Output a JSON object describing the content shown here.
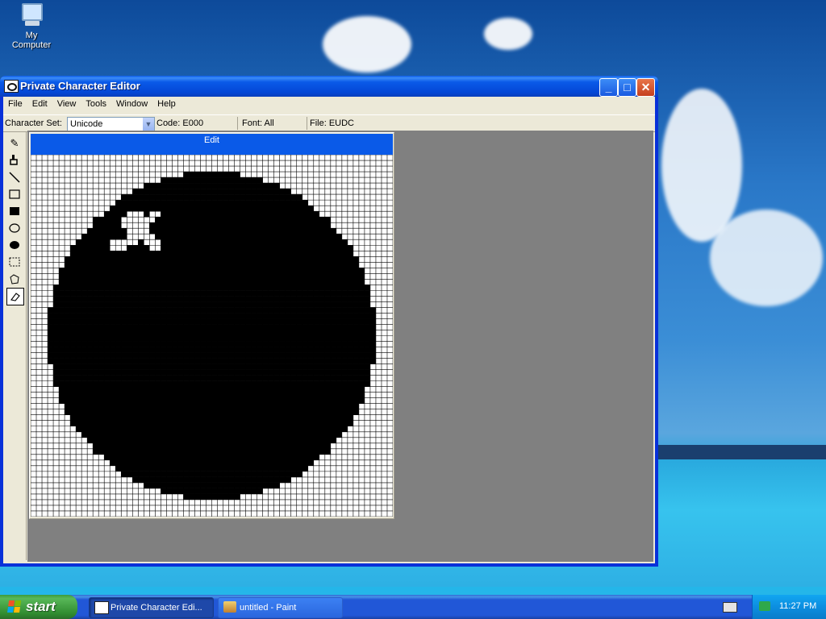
{
  "desktop": {
    "icons": [
      {
        "label": "My Computer",
        "icon": "my-computer-icon"
      }
    ]
  },
  "window": {
    "title": "Private Character Editor",
    "controls": {
      "minimize": "_",
      "maximize": "□",
      "close": "✕"
    },
    "menu": [
      "File",
      "Edit",
      "View",
      "Tools",
      "Window",
      "Help"
    ],
    "info": {
      "charset_label": "Character Set:",
      "charset_value": "Unicode",
      "code": "Code: E000",
      "font": "Font: All",
      "file": "File: EUDC"
    },
    "tools": [
      {
        "name": "pencil-tool",
        "glyph": "✎"
      },
      {
        "name": "brush-tool",
        "glyph": "🖌"
      },
      {
        "name": "line-tool",
        "glyph": "╲"
      },
      {
        "name": "hollow-rectangle-tool",
        "glyph": "□"
      },
      {
        "name": "filled-rectangle-tool",
        "glyph": "■"
      },
      {
        "name": "hollow-ellipse-tool",
        "glyph": "○"
      },
      {
        "name": "filled-ellipse-tool",
        "glyph": "●"
      },
      {
        "name": "rectangular-selection-tool",
        "glyph": "⬚"
      },
      {
        "name": "freeform-selection-tool",
        "glyph": "◌"
      },
      {
        "name": "eraser-tool",
        "glyph": "⌫",
        "selected": true
      }
    ],
    "edit_window": {
      "title": "Edit"
    }
  },
  "glyph": {
    "size": 64,
    "disc_center": [
      31.5,
      31.5
    ],
    "disc_radius": 29,
    "white_bitmap_rows": [
      {
        "row": 10,
        "cols": [
          [
            17,
            19
          ],
          [
            21,
            22
          ]
        ]
      },
      {
        "row": 11,
        "cols": [
          [
            16,
            21
          ]
        ]
      },
      {
        "row": 12,
        "cols": [
          [
            16,
            20
          ]
        ]
      },
      {
        "row": 13,
        "cols": [
          [
            17,
            20
          ]
        ]
      },
      {
        "row": 14,
        "cols": [
          [
            17,
            21
          ]
        ]
      },
      {
        "row": 15,
        "cols": [
          [
            14,
            18
          ],
          [
            20,
            22
          ]
        ]
      },
      {
        "row": 16,
        "cols": [
          [
            14,
            16
          ],
          [
            21,
            22
          ]
        ]
      }
    ]
  },
  "taskbar": {
    "start_label": "start",
    "tasks": [
      {
        "label": "Private Character Edi...",
        "active": true
      },
      {
        "label": "untitled - Paint",
        "active": false
      }
    ],
    "clock": "11:27 PM"
  },
  "colors": {
    "titlebar": "#0a5ae8",
    "window_bg": "#ece9d8",
    "mdi_bg": "#808080",
    "grid_line": "#000000",
    "pixel_on": "#000000"
  }
}
